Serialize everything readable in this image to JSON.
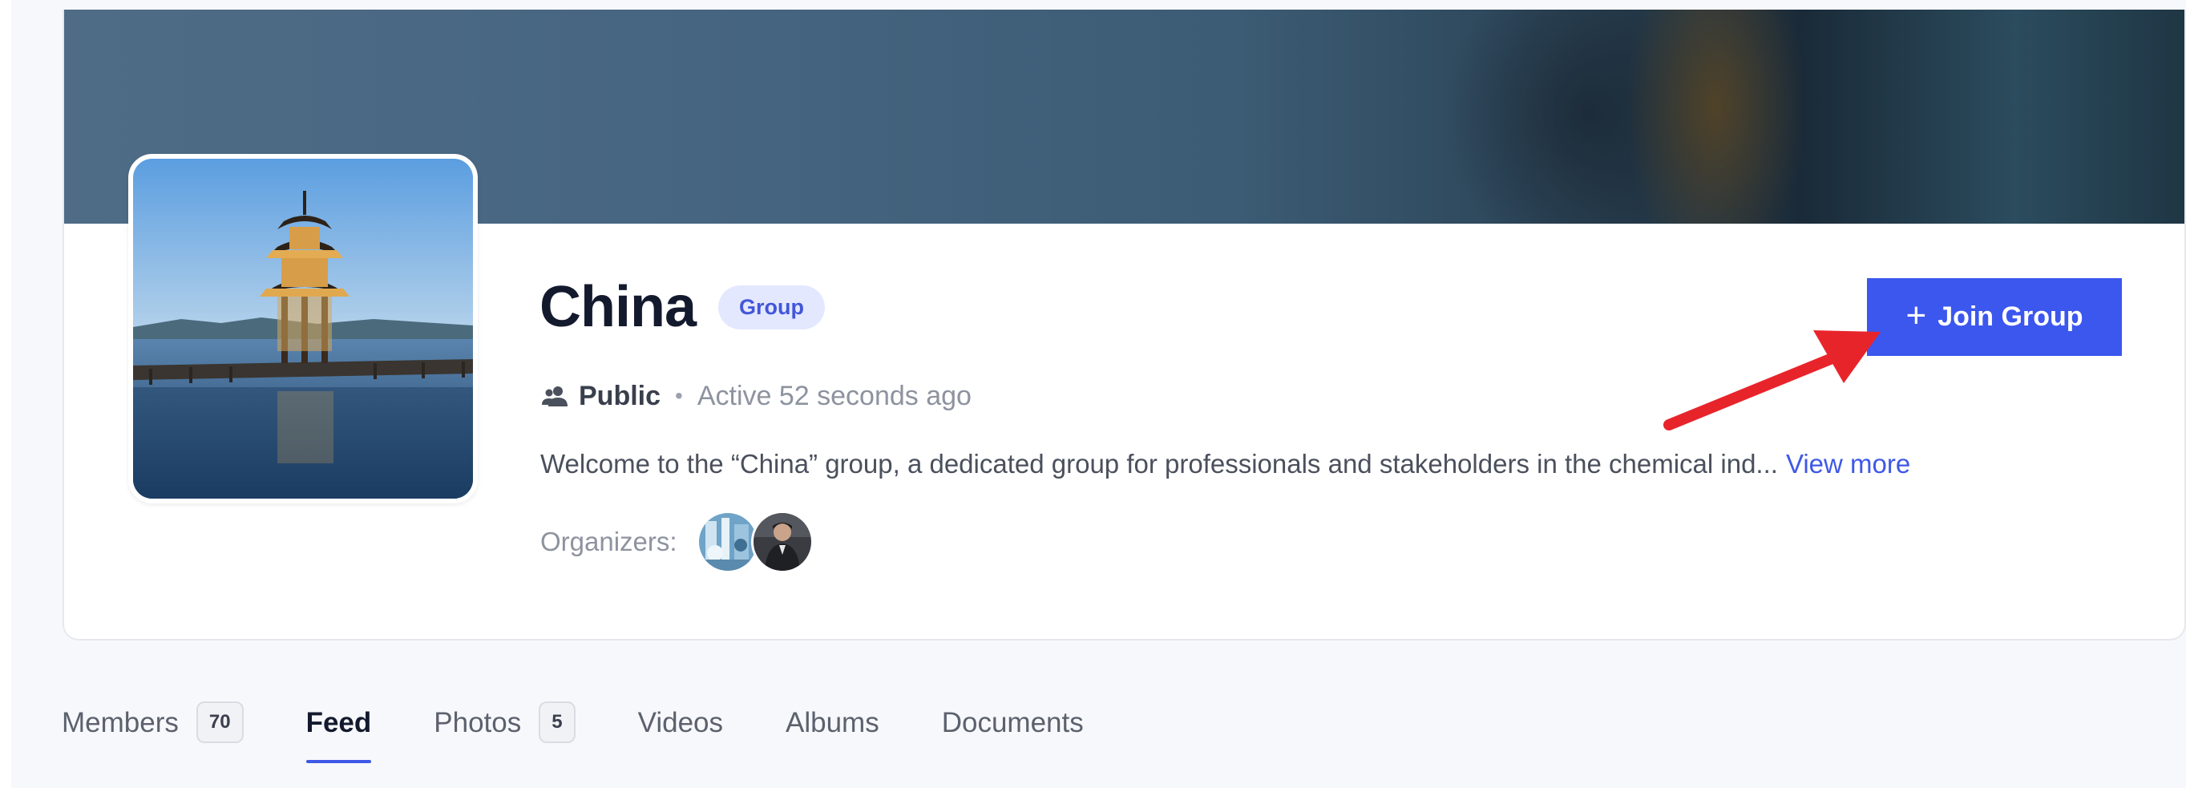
{
  "group": {
    "title": "China",
    "type_badge": "Group",
    "privacy": "Public",
    "meta_separator": "•",
    "activity": "Active 52 seconds ago",
    "description": "Welcome to the “China” group, a dedicated group for professionals and stakeholders in the chemical ind...",
    "view_more": "View more",
    "organizers_label": "Organizers:"
  },
  "actions": {
    "join_plus": "+",
    "join_label": "Join Group"
  },
  "tabs": [
    {
      "label": "Members",
      "count": "70",
      "active": false
    },
    {
      "label": "Feed",
      "active": true
    },
    {
      "label": "Photos",
      "count": "5",
      "active": false
    },
    {
      "label": "Videos",
      "active": false
    },
    {
      "label": "Albums",
      "active": false
    },
    {
      "label": "Documents",
      "active": false
    }
  ],
  "icons": {
    "privacy": "people-icon",
    "join": "plus-icon"
  },
  "colors": {
    "accent": "#3c57ee",
    "link": "#3f58e6",
    "badge_bg": "#e3e8ff",
    "badge_text": "#4257d9",
    "title": "#141a2e",
    "annotation_arrow": "#e8242b"
  }
}
